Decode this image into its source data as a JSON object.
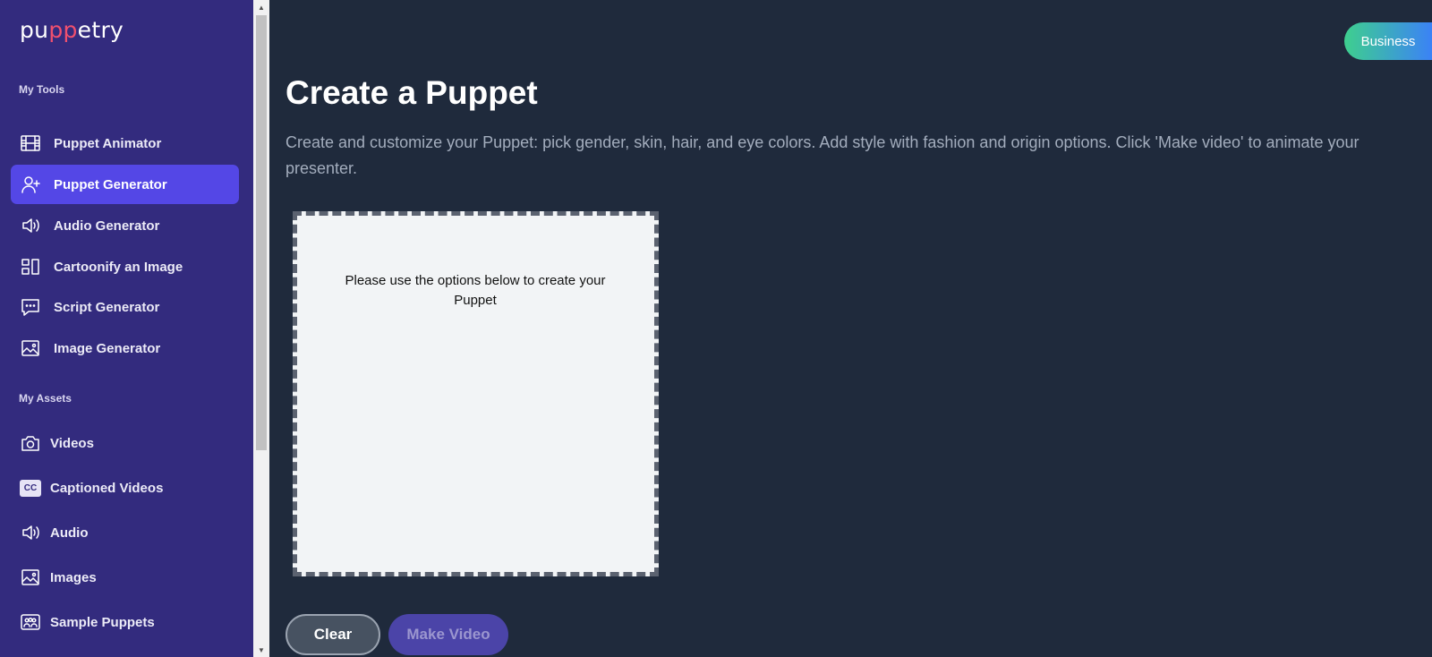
{
  "brand": {
    "logo_pre": "pu",
    "logo_accent": "pp",
    "logo_post": "etry"
  },
  "sidebar": {
    "tools_label": "My Tools",
    "tools": [
      {
        "label": "Puppet Animator",
        "icon": "film-icon"
      },
      {
        "label": "Puppet Generator",
        "icon": "user-plus-icon",
        "active": true
      },
      {
        "label": "Audio Generator",
        "icon": "speaker-icon"
      },
      {
        "label": "Cartoonify an Image",
        "icon": "layout-icon"
      },
      {
        "label": "Script Generator",
        "icon": "chat-bubble-icon"
      },
      {
        "label": "Image Generator",
        "icon": "image-icon"
      }
    ],
    "assets_label": "My Assets",
    "assets": [
      {
        "label": "Videos",
        "icon": "camera-icon"
      },
      {
        "label": "Captioned Videos",
        "icon": "cc-icon"
      },
      {
        "label": "Audio",
        "icon": "speaker-icon"
      },
      {
        "label": "Images",
        "icon": "image-icon"
      },
      {
        "label": "Sample Puppets",
        "icon": "group-icon"
      }
    ],
    "cc_text": "CC"
  },
  "header": {
    "plan_badge": "Business"
  },
  "main": {
    "title": "Create a Puppet",
    "subtitle": "Create and customize your Puppet: pick gender, skin, hair, and eye colors. Add style with fashion and origin options. Click 'Make video' to animate your presenter.",
    "preview_placeholder": "Please use the options below to create your Puppet",
    "clear_label": "Clear",
    "make_video_label": "Make Video"
  },
  "colors": {
    "sidebar_bg": "#332b7e",
    "active_item": "#5447e6",
    "main_bg": "#1f2a3c",
    "badge_gradient": [
      "#3ecf8e",
      "#3b82f6"
    ],
    "logo_accent": "#f0506e"
  }
}
